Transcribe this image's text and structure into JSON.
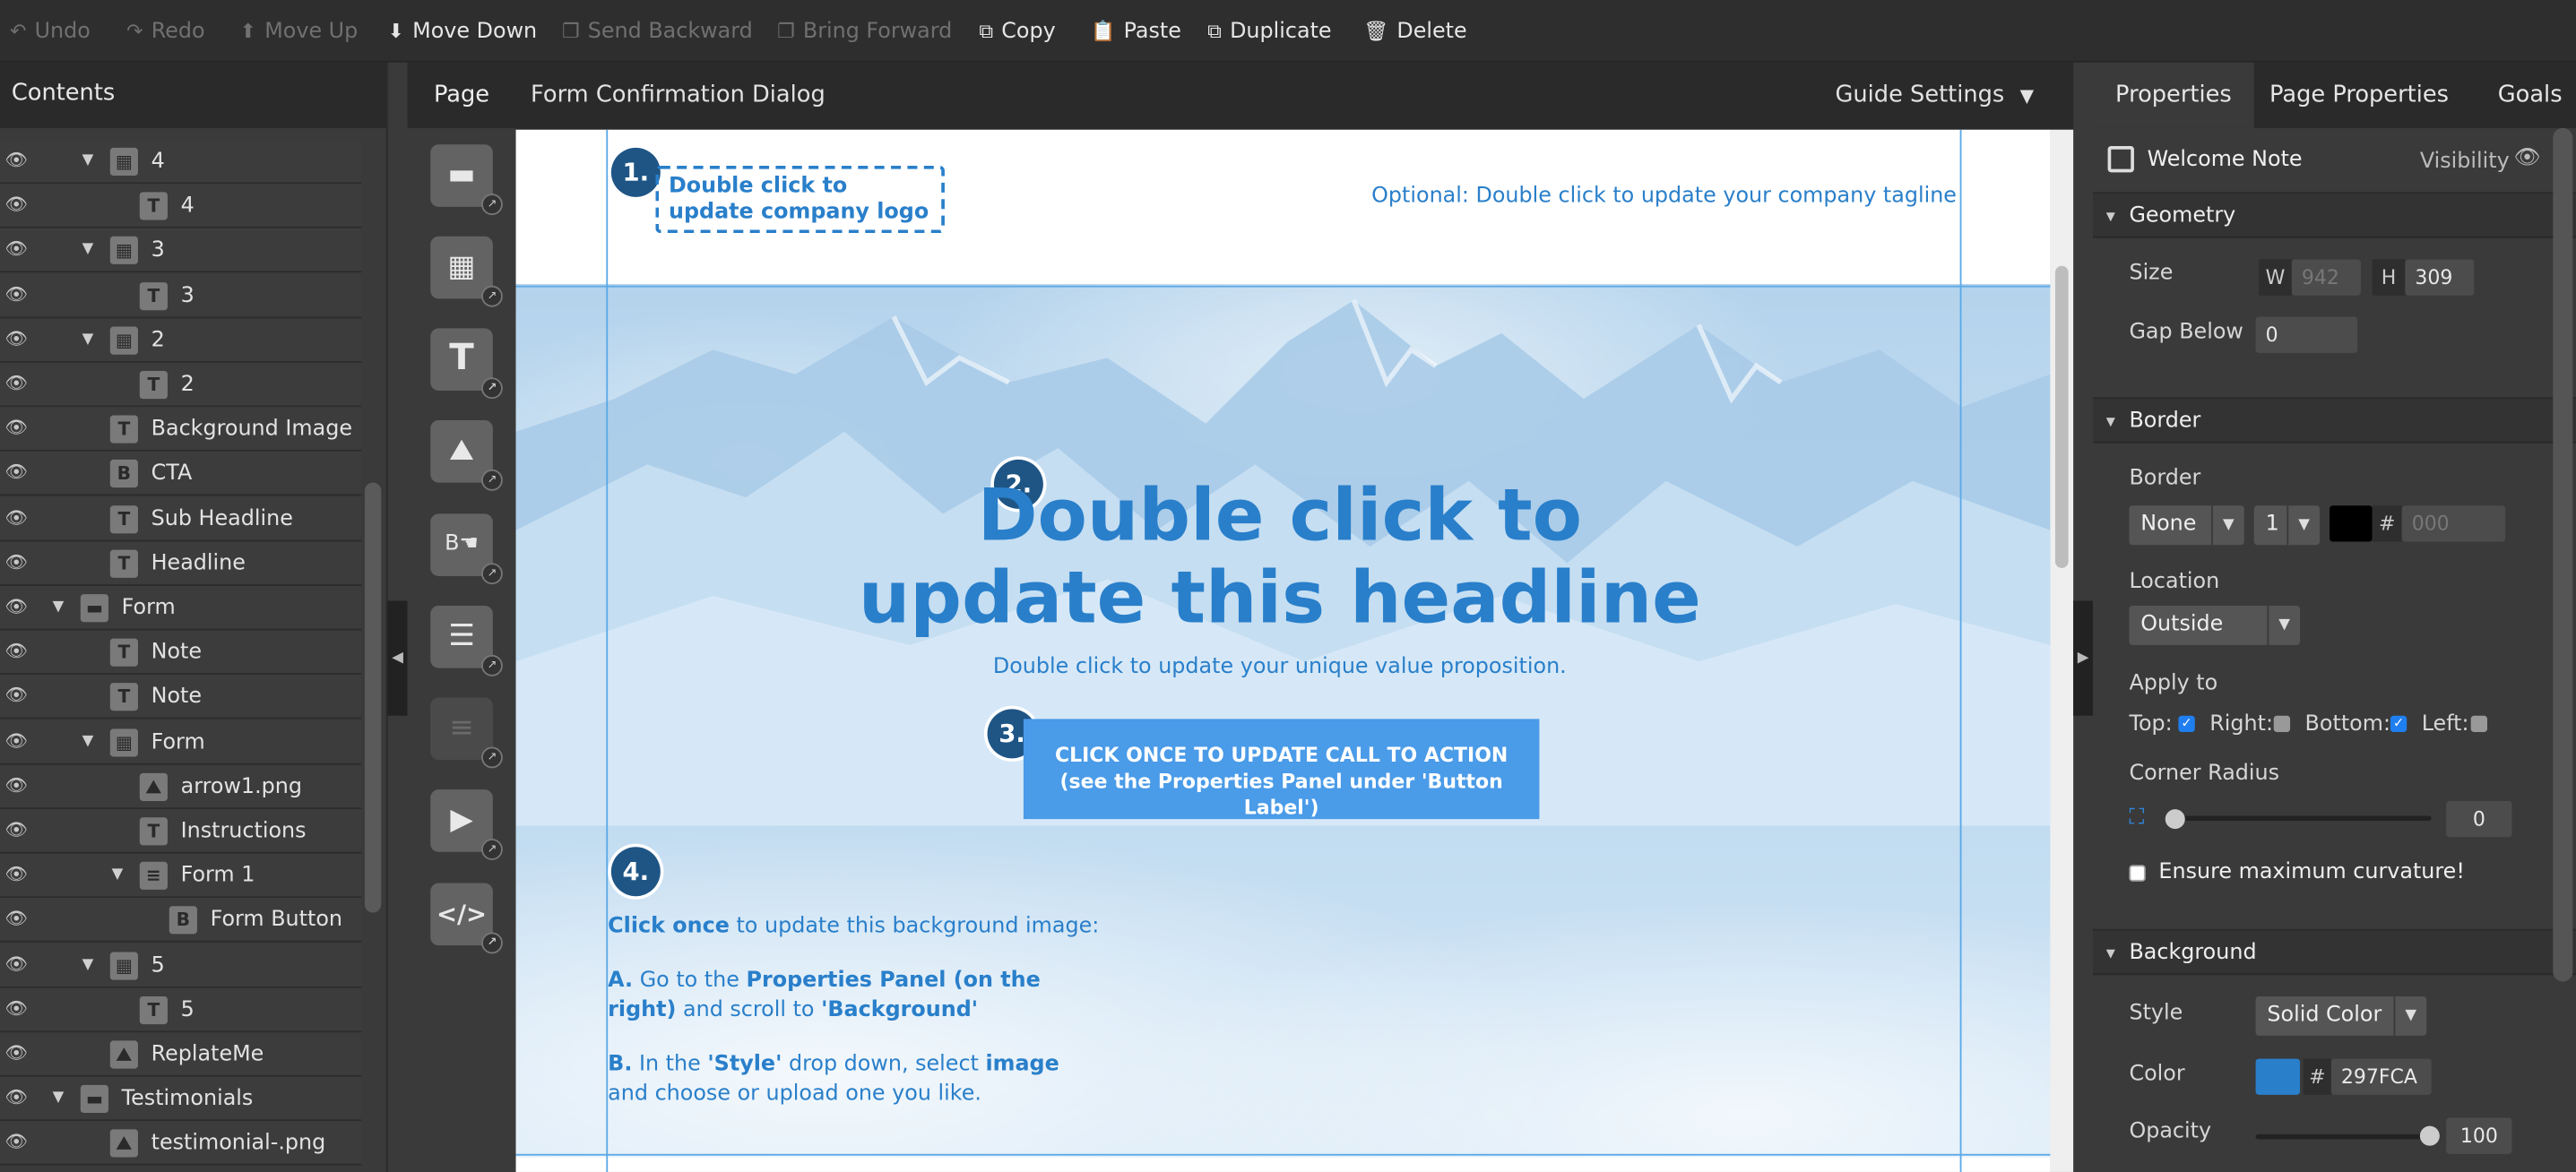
{
  "toolbar": {
    "undo": "Undo",
    "redo": "Redo",
    "move_up": "Move Up",
    "move_down": "Move Down",
    "send_backward": "Send Backward",
    "bring_forward": "Bring Forward",
    "copy": "Copy",
    "paste": "Paste",
    "duplicate": "Duplicate",
    "delete": "Delete"
  },
  "contents": {
    "title": "Contents",
    "rows": [
      {
        "label": "4",
        "icon": "box",
        "expanded": true
      },
      {
        "label": "4",
        "icon": "text"
      },
      {
        "label": "3",
        "icon": "box",
        "expanded": true
      },
      {
        "label": "3",
        "icon": "text"
      },
      {
        "label": "2",
        "icon": "box",
        "expanded": true
      },
      {
        "label": "2",
        "icon": "text"
      },
      {
        "label": "Background Image",
        "icon": "text"
      },
      {
        "label": "CTA",
        "icon": "button"
      },
      {
        "label": "Sub Headline",
        "icon": "text"
      },
      {
        "label": "Headline",
        "icon": "text"
      },
      {
        "label": "Form",
        "icon": "section",
        "expanded": true
      },
      {
        "label": "Note",
        "icon": "text"
      },
      {
        "label": "Note",
        "icon": "text"
      },
      {
        "label": "Form",
        "icon": "box",
        "expanded": true
      },
      {
        "label": "arrow1.png",
        "icon": "image"
      },
      {
        "label": "Instructions",
        "icon": "text"
      },
      {
        "label": "Form 1",
        "icon": "form",
        "expanded": true
      },
      {
        "label": "Form Button",
        "icon": "button"
      },
      {
        "label": "5",
        "icon": "box",
        "expanded": true
      },
      {
        "label": "5",
        "icon": "text"
      },
      {
        "label": "ReplateMe",
        "icon": "image"
      },
      {
        "label": "Testimonials",
        "icon": "section",
        "expanded": true
      },
      {
        "label": "testimonial-.png",
        "icon": "image"
      }
    ]
  },
  "page_tab": "Page",
  "document_title": "Form Confirmation Dialog",
  "guide_settings": "Guide Settings",
  "canvas": {
    "logo_placeholder": "Double click to update company logo",
    "tagline": "Optional: Double click to update your company tagline",
    "headline": "Double click to update this headline",
    "value_prop": "Double click to update your unique value proposition.",
    "cta": "CLICK ONCE TO UPDATE CALL TO ACTION  (see the Properties Panel under 'Button Label')",
    "badges": [
      "1.",
      "2.",
      "3.",
      "4."
    ],
    "note": {
      "line1_bold": "Click once",
      "line1_rest": " to update this background image:",
      "a_prefix": "A.",
      "a_text1": " Go to the ",
      "a_bold1": "Properties Panel (on the right)",
      "a_text2": " and scroll to ",
      "a_bold2": "'Background'",
      "b_prefix": "B.",
      "b_text1": " In the ",
      "b_bold1": "'Style'",
      "b_text2": " drop down, select ",
      "b_bold2": "image",
      "b_text3": " and choose or upload one you like."
    }
  },
  "properties": {
    "tabs": [
      "Properties",
      "Page Properties",
      "Goals"
    ],
    "element_name": "Welcome Note",
    "visibility": "Visibility",
    "geometry": {
      "title": "Geometry",
      "size_label": "Size",
      "w_tag": "W",
      "w_value": "942",
      "h_tag": "H",
      "h_value": "309",
      "gap_label": "Gap Below",
      "gap_value": "0"
    },
    "border": {
      "title": "Border",
      "border_label": "Border",
      "style": "None",
      "width": "1",
      "hash": "#",
      "color_placeholder": "000",
      "location_label": "Location",
      "location": "Outside",
      "apply_label": "Apply to",
      "top": "Top:",
      "right": "Right:",
      "bottom": "Bottom:",
      "left": "Left:",
      "top_checked": true,
      "right_checked": false,
      "bottom_checked": true,
      "left_checked": false,
      "radius_label": "Corner Radius",
      "radius_value": "0",
      "max_curve": "Ensure maximum curvature!"
    },
    "background": {
      "title": "Background",
      "style_label": "Style",
      "style": "Solid Color",
      "color_label": "Color",
      "hash": "#",
      "color_value": "297FCA",
      "swatch": "#297fca",
      "opacity_label": "Opacity",
      "opacity_value": "100"
    }
  },
  "colors": {
    "accent": "#297fca",
    "cta": "#4a9be8",
    "badge": "#1e5585"
  }
}
